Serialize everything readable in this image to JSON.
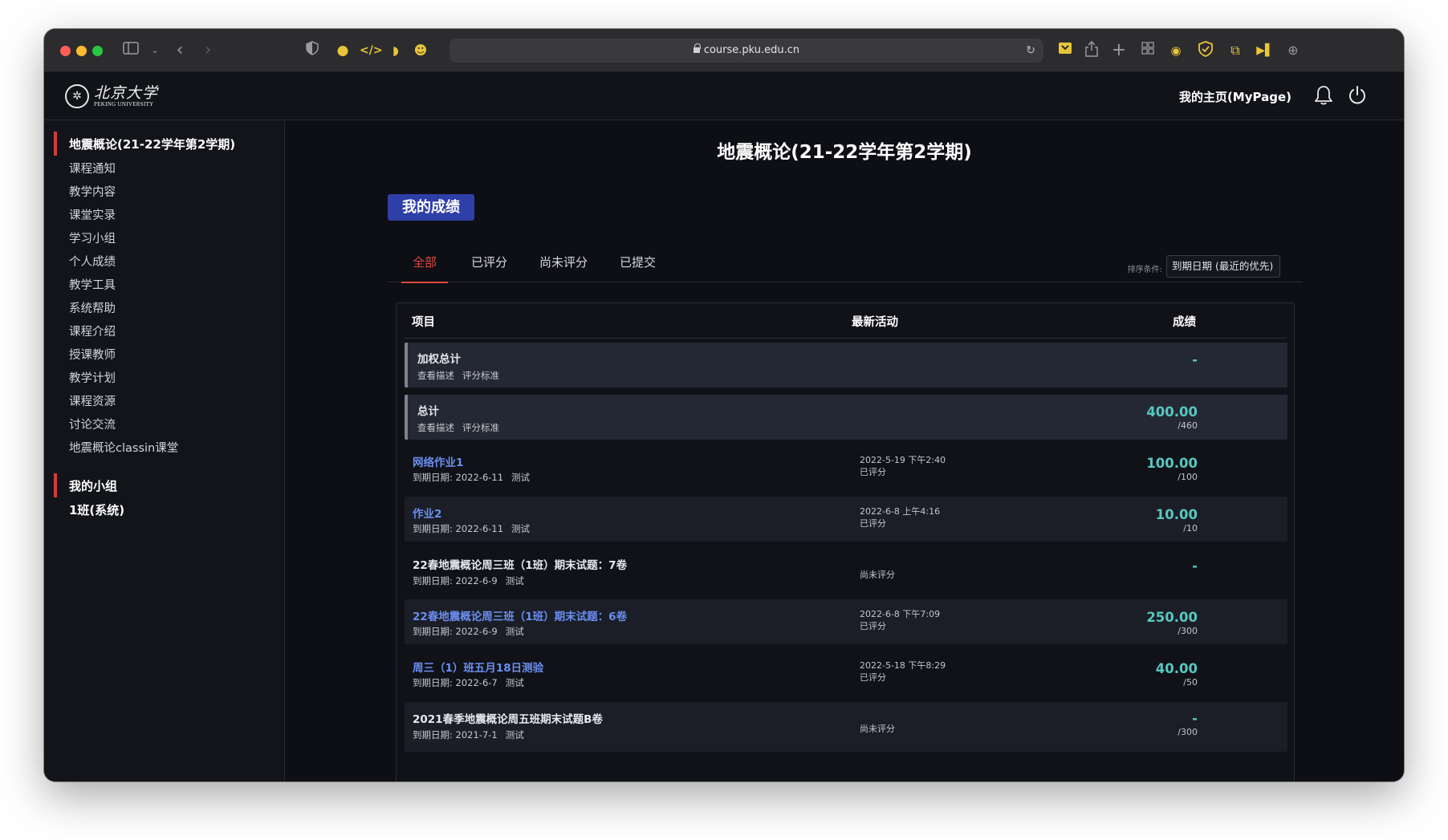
{
  "browser": {
    "url": "course.pku.edu.cn",
    "toolbar_icons": [
      "sidebar-icon",
      "chevron-down-icon",
      "back-icon",
      "forward-icon",
      "shield-icon",
      "flame-icon",
      "code-icon",
      "rss-icon",
      "mask-icon",
      "reload-icon",
      "bookmark-icon",
      "share-icon",
      "new-tab-icon",
      "tab-overview-icon",
      "extension-icon",
      "adblock-icon",
      "translate-icon",
      "speed-icon",
      "download-icon"
    ]
  },
  "header": {
    "logo_cn": "北京大学",
    "logo_en": "PEKING UNIVERSITY",
    "mypage": "我的主页(MyPage)"
  },
  "sidebar": {
    "course_title": "地震概论(21-22学年第2学期)",
    "items": [
      "课程通知",
      "教学内容",
      "课堂实录",
      "学习小组",
      "个人成绩",
      "教学工具",
      "系统帮助",
      "课程介绍",
      "授课教师",
      "教学计划",
      "课程资源",
      "讨论交流",
      "地震概论classin课堂"
    ],
    "groups_title": "我的小组",
    "group_name": "1班(系统)"
  },
  "main": {
    "title": "地震概论(21-22学年第2学期)",
    "heading": "我的成绩",
    "tabs": [
      "全部",
      "已评分",
      "尚未评分",
      "已提交"
    ],
    "sort_label": "排序条件:",
    "sort_value": "到期日期 (最近的优先)",
    "columns": [
      "项目",
      "最新活动",
      "成绩"
    ]
  },
  "rows": [
    {
      "title": "加权总计",
      "links": [
        "查看描述",
        "评分标准"
      ],
      "score": "-",
      "outof": ""
    },
    {
      "title": "总计",
      "links": [
        "查看描述",
        "评分标准"
      ],
      "score": "400.00",
      "outof": "/460"
    },
    {
      "title": "网络作业1",
      "due": "到期日期: 2022-6-11",
      "type": "测试",
      "activity_date": "2022-5-19 下午2:40",
      "status": "已评分",
      "score": "100.00",
      "outof": "/100"
    },
    {
      "title": "作业2",
      "due": "到期日期: 2022-6-11",
      "type": "测试",
      "activity_date": "2022-6-8 上午4:16",
      "status": "已评分",
      "score": "10.00",
      "outof": "/10"
    },
    {
      "title": "22春地震概论周三班（1班）期末试题：7卷",
      "due": "到期日期: 2022-6-9",
      "type": "测试",
      "activity_date": "",
      "status": "尚未评分",
      "score": "-",
      "outof": ""
    },
    {
      "title": "22春地震概论周三班（1班）期末试题：6卷",
      "due": "到期日期: 2022-6-9",
      "type": "测试",
      "activity_date": "2022-6-8 下午7:09",
      "status": "已评分",
      "score": "250.00",
      "outof": "/300"
    },
    {
      "title": "周三（1）班五月18日测验",
      "due": "到期日期: 2022-6-7",
      "type": "测试",
      "activity_date": "2022-5-18 下午8:29",
      "status": "已评分",
      "score": "40.00",
      "outof": "/50"
    },
    {
      "title": "2021春季地震概论周五班期末试题B卷",
      "due": "到期日期: 2021-7-1",
      "type": "测试",
      "activity_date": "",
      "status": "尚未评分",
      "score": "-",
      "outof": "/300"
    }
  ]
}
